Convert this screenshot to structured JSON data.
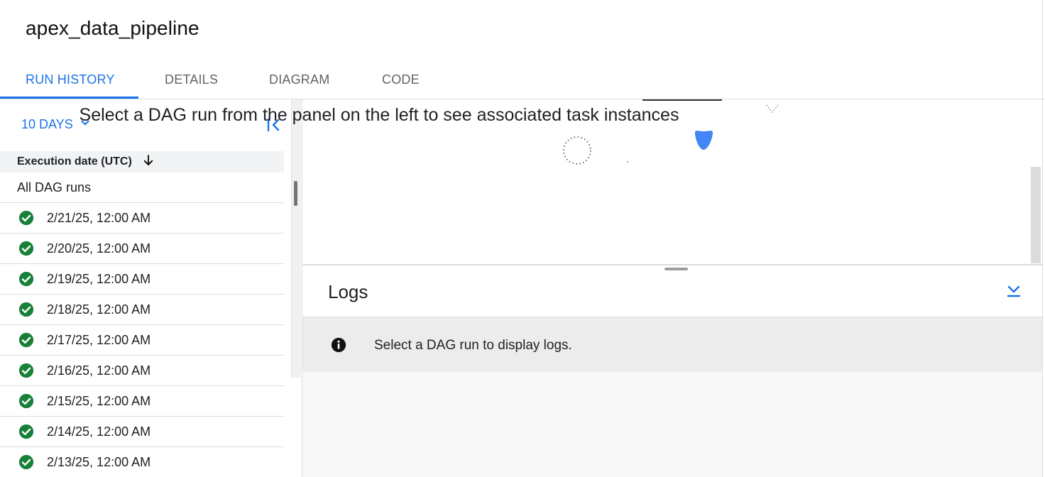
{
  "page": {
    "title": "apex_data_pipeline"
  },
  "tabs": [
    {
      "label": "RUN HISTORY",
      "active": true
    },
    {
      "label": "DETAILS",
      "active": false
    },
    {
      "label": "DIAGRAM",
      "active": false
    },
    {
      "label": "CODE",
      "active": false
    }
  ],
  "colors": {
    "accent": "#1a73e8",
    "success": "#188038"
  },
  "left_panel": {
    "range_label": "10 DAYS",
    "column_header": "Execution date (UTC)",
    "all_runs_label": "All DAG runs",
    "runs": [
      {
        "date": "2/21/25, 12:00 AM",
        "status": "success"
      },
      {
        "date": "2/20/25, 12:00 AM",
        "status": "success"
      },
      {
        "date": "2/19/25, 12:00 AM",
        "status": "success"
      },
      {
        "date": "2/18/25, 12:00 AM",
        "status": "success"
      },
      {
        "date": "2/17/25, 12:00 AM",
        "status": "success"
      },
      {
        "date": "2/16/25, 12:00 AM",
        "status": "success"
      },
      {
        "date": "2/15/25, 12:00 AM",
        "status": "success"
      },
      {
        "date": "2/14/25, 12:00 AM",
        "status": "success"
      },
      {
        "date": "2/13/25, 12:00 AM",
        "status": "success"
      }
    ]
  },
  "main": {
    "empty_message": "Select a DAG run from the panel on the left to see associated task instances"
  },
  "logs": {
    "title": "Logs",
    "message": "Select a DAG run to display logs."
  }
}
